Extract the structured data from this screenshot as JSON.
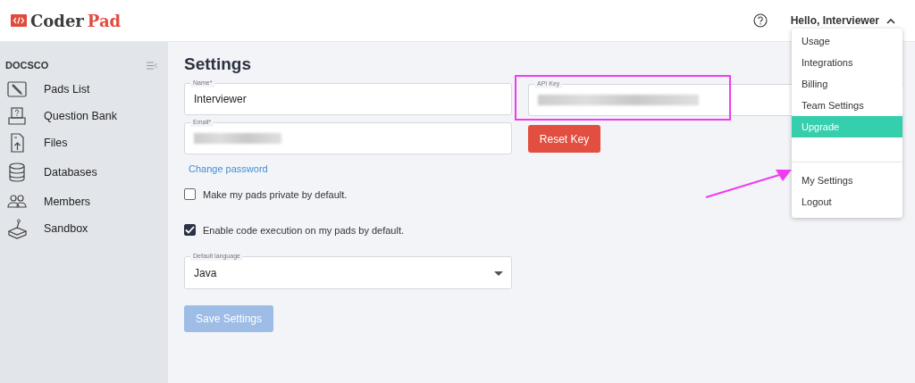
{
  "header": {
    "logo_prefix": "Coder",
    "logo_suffix": "Pad",
    "greeting": "Hello, Interviewer",
    "menu_open": true
  },
  "sidebar": {
    "team": "DOCSCO",
    "items": [
      {
        "label": "Pads List"
      },
      {
        "label": "Question Bank"
      },
      {
        "label": "Files"
      },
      {
        "label": "Databases"
      },
      {
        "label": "Members"
      },
      {
        "label": "Sandbox"
      }
    ]
  },
  "settings": {
    "title": "Settings",
    "name_field": {
      "label": "Name*",
      "value": "Interviewer"
    },
    "email_field": {
      "label": "Email*",
      "redacted": true
    },
    "change_password": "Change password",
    "checkboxes": [
      {
        "label": "Make my pads private by default.",
        "checked": false
      },
      {
        "label": "Enable code execution on my pads by default.",
        "checked": true
      }
    ],
    "language_field": {
      "label": "Default language",
      "value": "Java"
    },
    "save_button": {
      "label": "Save Settings",
      "disabled": true
    },
    "api_key_field": {
      "label": "API Key",
      "redacted": true,
      "highlighted": true
    },
    "reset_button": "Reset Key"
  },
  "user_menu": {
    "items": [
      {
        "label": "Usage",
        "selected": false
      },
      {
        "label": "Integrations",
        "selected": false
      },
      {
        "label": "Billing",
        "selected": false
      },
      {
        "label": "Team Settings",
        "selected": false
      },
      {
        "label": "Upgrade",
        "selected": true
      },
      {
        "label": "My Settings",
        "selected": false,
        "separator_before": true
      },
      {
        "label": "Logout",
        "selected": false
      }
    ]
  },
  "annotation": {
    "arrow": true
  }
}
